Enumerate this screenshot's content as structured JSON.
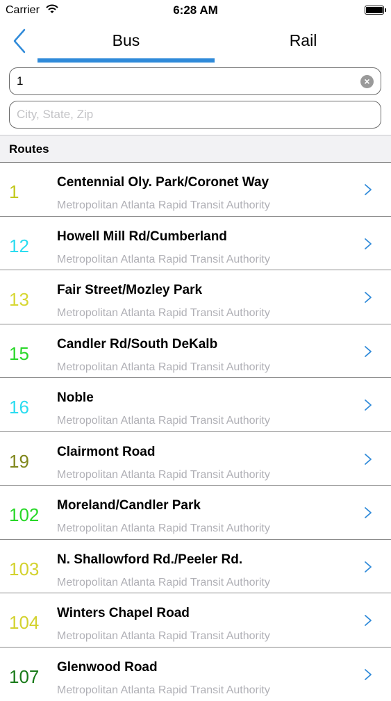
{
  "status_bar": {
    "carrier": "Carrier",
    "time": "6:28 AM"
  },
  "nav": {
    "tabs": [
      {
        "label": "Bus",
        "selected": true
      },
      {
        "label": "Rail",
        "selected": false
      }
    ],
    "accent_color": "#2f8ad9"
  },
  "search": {
    "route_value": "1",
    "location_value": "",
    "location_placeholder": "City, State, Zip"
  },
  "section_header": "Routes",
  "routes": [
    {
      "number": "1",
      "name": "Centennial Oly. Park/Coronet Way",
      "agency": "Metropolitan Atlanta Rapid Transit Authority",
      "color": "#c2c81c"
    },
    {
      "number": "12",
      "name": "Howell Mill Rd/Cumberland",
      "agency": "Metropolitan Atlanta Rapid Transit Authority",
      "color": "#2bdcf0"
    },
    {
      "number": "13",
      "name": "Fair Street/Mozley Park",
      "agency": "Metropolitan Atlanta Rapid Transit Authority",
      "color": "#d7d733"
    },
    {
      "number": "15",
      "name": "Candler Rd/South DeKalb",
      "agency": "Metropolitan Atlanta Rapid Transit Authority",
      "color": "#28d728"
    },
    {
      "number": "16",
      "name": "Noble",
      "agency": "Metropolitan Atlanta Rapid Transit Authority",
      "color": "#2bdcf0"
    },
    {
      "number": "19",
      "name": "Clairmont Road",
      "agency": "Metropolitan Atlanta Rapid Transit Authority",
      "color": "#7f861a"
    },
    {
      "number": "102",
      "name": "Moreland/Candler Park",
      "agency": "Metropolitan Atlanta Rapid Transit Authority",
      "color": "#28d728"
    },
    {
      "number": "103",
      "name": "N. Shallowford Rd./Peeler Rd.",
      "agency": "Metropolitan Atlanta Rapid Transit Authority",
      "color": "#d3d22e"
    },
    {
      "number": "104",
      "name": "Winters Chapel Road",
      "agency": "Metropolitan Atlanta Rapid Transit Authority",
      "color": "#d3d22e"
    },
    {
      "number": "107",
      "name": "Glenwood Road",
      "agency": "Metropolitan Atlanta Rapid Transit Authority",
      "color": "#197a19"
    }
  ]
}
